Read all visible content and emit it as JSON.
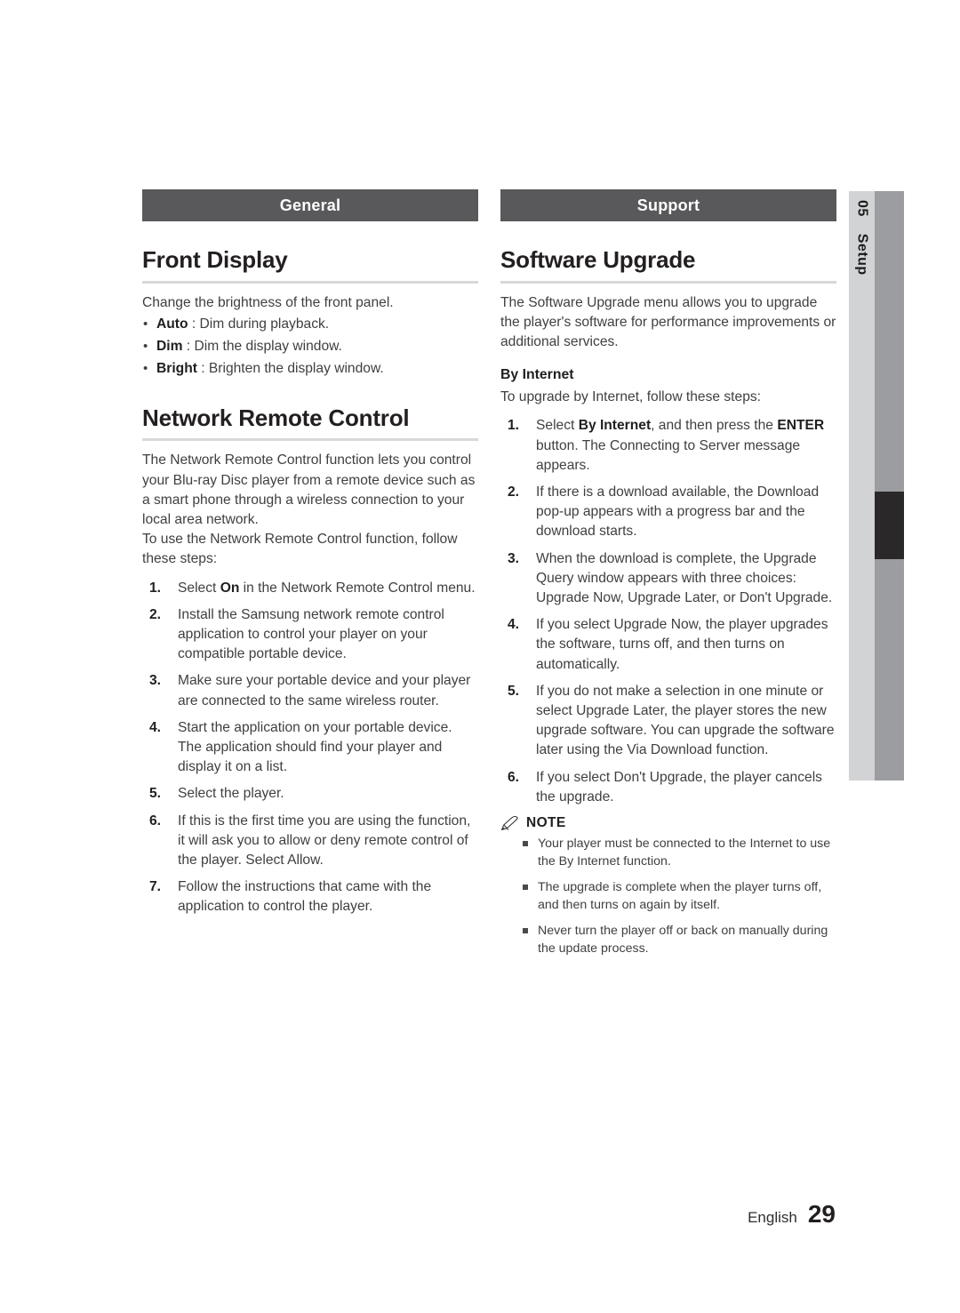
{
  "side_tab": {
    "chapter_number": "05",
    "chapter_name": "Setup"
  },
  "left_column": {
    "banner": "General",
    "sections": [
      {
        "heading": "Front Display",
        "intro": "Change the brightness of the front panel.",
        "bullets": [
          {
            "term": "Auto",
            "sep": " : ",
            "text": "Dim during playback."
          },
          {
            "term": "Dim",
            "sep": " : ",
            "text": "Dim the display window."
          },
          {
            "term": "Bright",
            "sep": " : ",
            "text": "Brighten the display window."
          }
        ]
      },
      {
        "heading": "Network Remote Control",
        "para1": "The Network Remote Control function lets you control your Blu-ray Disc player from a remote device such as a smart phone through a wireless connection to your local area network.",
        "para2": "To use the Network Remote Control function, follow these steps:",
        "steps": [
          {
            "num": "1.",
            "pre": "Select ",
            "bold": "On",
            "post": " in the Network Remote Control menu."
          },
          {
            "num": "2.",
            "pre": "Install the Samsung network remote control application to control your player on your compatible portable device.",
            "bold": "",
            "post": ""
          },
          {
            "num": "3.",
            "pre": "Make sure your portable device and your player are connected to the same wireless router.",
            "bold": "",
            "post": ""
          },
          {
            "num": "4.",
            "pre": "Start the application on your portable device. The application should find your player and display it on a list.",
            "bold": "",
            "post": ""
          },
          {
            "num": "5.",
            "pre": "Select the player.",
            "bold": "",
            "post": ""
          },
          {
            "num": "6.",
            "pre": "If this is the first time you are using the function, it will ask you to allow or deny remote control of the player. Select Allow.",
            "bold": "",
            "post": ""
          },
          {
            "num": "7.",
            "pre": "Follow the instructions that came with the application to control the player.",
            "bold": "",
            "post": ""
          }
        ]
      }
    ]
  },
  "right_column": {
    "banner": "Support",
    "heading": "Software Upgrade",
    "intro": "The Software Upgrade menu allows you to upgrade the player's software for performance improvements or additional services.",
    "subhead": "By Internet",
    "subintro": "To upgrade by Internet, follow these steps:",
    "steps": [
      {
        "num": "1.",
        "pre": "Select ",
        "bold": "By Internet",
        "mid": ", and then press the ",
        "bold2": "ENTER",
        "post": " button. The Connecting to Server message appears."
      },
      {
        "num": "2.",
        "pre": "If there is a download available, the Download pop-up appears with a progress bar and the download starts.",
        "bold": "",
        "mid": "",
        "bold2": "",
        "post": ""
      },
      {
        "num": "3.",
        "pre": "When the download is complete, the Upgrade Query window appears with three choices: Upgrade Now, Upgrade Later, or Don't Upgrade.",
        "bold": "",
        "mid": "",
        "bold2": "",
        "post": ""
      },
      {
        "num": "4.",
        "pre": "If you select Upgrade Now, the player upgrades the software, turns off, and then turns on automatically.",
        "bold": "",
        "mid": "",
        "bold2": "",
        "post": ""
      },
      {
        "num": "5.",
        "pre": "If you do not make a selection in one minute or select Upgrade Later, the player stores the new upgrade software. You can upgrade the software later using the Via Download function.",
        "bold": "",
        "mid": "",
        "bold2": "",
        "post": ""
      },
      {
        "num": "6.",
        "pre": "If you select Don't Upgrade, the player cancels the upgrade.",
        "bold": "",
        "mid": "",
        "bold2": "",
        "post": ""
      }
    ],
    "note": {
      "label": "NOTE",
      "icon": "pencil-icon",
      "items": [
        "Your player must be connected to the Internet to use the By Internet function.",
        "The upgrade is complete when the player turns off, and then turns on again by itself.",
        "Never turn the player off or back on manually during the update process."
      ]
    }
  },
  "footer": {
    "language": "English",
    "page_number": "29"
  },
  "colors": {
    "banner_bg": "#59595b",
    "side_tab_label_bg": "#d2d3d5",
    "side_tab_bar_bg": "#9b9da0",
    "side_tab_marker_bg": "#2b2829",
    "rule": "#d8d8da",
    "body_text": "#3f3f41"
  }
}
